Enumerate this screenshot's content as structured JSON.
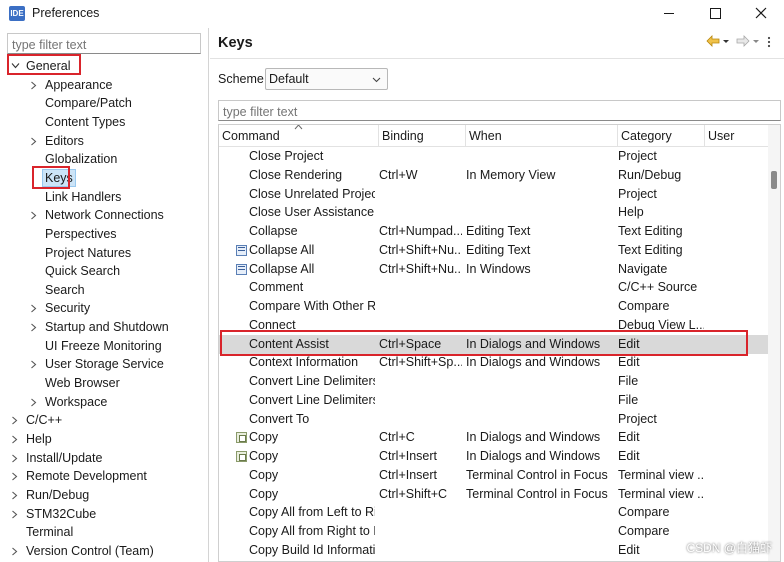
{
  "window": {
    "app_icon_text": "IDE",
    "title": "Preferences"
  },
  "left": {
    "filter_placeholder": "type filter text",
    "tree": [
      {
        "label": "General",
        "level": 0,
        "expanded": true
      },
      {
        "label": "Appearance",
        "level": 1,
        "chevron": true
      },
      {
        "label": "Compare/Patch",
        "level": 1
      },
      {
        "label": "Content Types",
        "level": 1
      },
      {
        "label": "Editors",
        "level": 1,
        "chevron": true
      },
      {
        "label": "Globalization",
        "level": 1
      },
      {
        "label": "Keys",
        "level": 1,
        "selected": true
      },
      {
        "label": "Link Handlers",
        "level": 1
      },
      {
        "label": "Network Connections",
        "level": 1,
        "chevron": true
      },
      {
        "label": "Perspectives",
        "level": 1
      },
      {
        "label": "Project Natures",
        "level": 1
      },
      {
        "label": "Quick Search",
        "level": 1
      },
      {
        "label": "Search",
        "level": 1
      },
      {
        "label": "Security",
        "level": 1,
        "chevron": true
      },
      {
        "label": "Startup and Shutdown",
        "level": 1,
        "chevron": true
      },
      {
        "label": "UI Freeze Monitoring",
        "level": 1
      },
      {
        "label": "User Storage Service",
        "level": 1,
        "chevron": true
      },
      {
        "label": "Web Browser",
        "level": 1
      },
      {
        "label": "Workspace",
        "level": 1,
        "chevron": true
      },
      {
        "label": "C/C++",
        "level": 0,
        "chevron": true
      },
      {
        "label": "Help",
        "level": 0,
        "chevron": true
      },
      {
        "label": "Install/Update",
        "level": 0,
        "chevron": true
      },
      {
        "label": "Remote Development",
        "level": 0,
        "chevron": true
      },
      {
        "label": "Run/Debug",
        "level": 0,
        "chevron": true
      },
      {
        "label": "STM32Cube",
        "level": 0,
        "chevron": true
      },
      {
        "label": "Terminal",
        "level": 0
      },
      {
        "label": "Version Control (Team)",
        "level": 0,
        "chevron": true
      }
    ]
  },
  "right": {
    "page_title": "Keys",
    "scheme_label": "Scheme:",
    "scheme_value": "Default",
    "filter_placeholder": "type filter text",
    "columns": [
      "Command",
      "Binding",
      "When",
      "Category",
      "User"
    ],
    "rows": [
      {
        "command": "Close Project",
        "binding": "",
        "when": "",
        "category": "Project",
        "user": "",
        "icon": ""
      },
      {
        "command": "Close Rendering",
        "binding": "Ctrl+W",
        "when": "In Memory View",
        "category": "Run/Debug",
        "user": "",
        "icon": ""
      },
      {
        "command": "Close Unrelated Projects",
        "binding": "",
        "when": "",
        "category": "Project",
        "user": "",
        "icon": ""
      },
      {
        "command": "Close User Assistance Tra",
        "binding": "",
        "when": "",
        "category": "Help",
        "user": "",
        "icon": ""
      },
      {
        "command": "Collapse",
        "binding": "Ctrl+Numpad...",
        "when": "Editing Text",
        "category": "Text Editing",
        "user": "",
        "icon": ""
      },
      {
        "command": "Collapse All",
        "binding": "Ctrl+Shift+Nu...",
        "when": "Editing Text",
        "category": "Text Editing",
        "user": "",
        "icon": "collapse"
      },
      {
        "command": "Collapse All",
        "binding": "Ctrl+Shift+Nu...",
        "when": "In Windows",
        "category": "Navigate",
        "user": "",
        "icon": "collapse"
      },
      {
        "command": "Comment",
        "binding": "",
        "when": "",
        "category": "C/C++ Source",
        "user": "",
        "icon": ""
      },
      {
        "command": "Compare With Other Res",
        "binding": "",
        "when": "",
        "category": "Compare",
        "user": "",
        "icon": ""
      },
      {
        "command": "Connect",
        "binding": "",
        "when": "",
        "category": "Debug View L...",
        "user": "",
        "icon": ""
      },
      {
        "command": "Content Assist",
        "binding": "Ctrl+Space",
        "when": "In Dialogs and Windows",
        "category": "Edit",
        "user": "",
        "icon": "",
        "highlighted": true
      },
      {
        "command": "Context Information",
        "binding": "Ctrl+Shift+Sp...",
        "when": "In Dialogs and Windows",
        "category": "Edit",
        "user": "",
        "icon": ""
      },
      {
        "command": "Convert Line Delimiters t",
        "binding": "",
        "when": "",
        "category": "File",
        "user": "",
        "icon": ""
      },
      {
        "command": "Convert Line Delimiters t",
        "binding": "",
        "when": "",
        "category": "File",
        "user": "",
        "icon": ""
      },
      {
        "command": "Convert To",
        "binding": "",
        "when": "",
        "category": "Project",
        "user": "",
        "icon": ""
      },
      {
        "command": "Copy",
        "binding": "Ctrl+C",
        "when": "In Dialogs and Windows",
        "category": "Edit",
        "user": "",
        "icon": "copy"
      },
      {
        "command": "Copy",
        "binding": "Ctrl+Insert",
        "when": "In Dialogs and Windows",
        "category": "Edit",
        "user": "",
        "icon": "copy"
      },
      {
        "command": "Copy",
        "binding": "Ctrl+Insert",
        "when": "Terminal Control in Focus",
        "category": "Terminal view ...",
        "user": "",
        "icon": ""
      },
      {
        "command": "Copy",
        "binding": "Ctrl+Shift+C",
        "when": "Terminal Control in Focus",
        "category": "Terminal view ...",
        "user": "",
        "icon": ""
      },
      {
        "command": "Copy All from Left to Rig",
        "binding": "",
        "when": "",
        "category": "Compare",
        "user": "",
        "icon": ""
      },
      {
        "command": "Copy All from Right to L",
        "binding": "",
        "when": "",
        "category": "Compare",
        "user": "",
        "icon": ""
      },
      {
        "command": "Copy Build Id Informatio",
        "binding": "",
        "when": "",
        "category": "Edit",
        "user": "",
        "icon": ""
      }
    ]
  },
  "watermark": "CSDN @白猫虾",
  "colors": {
    "annotation_red": "#d9242b",
    "selection_blue": "#cce4f7",
    "row_highlight": "#d9d9d9"
  }
}
